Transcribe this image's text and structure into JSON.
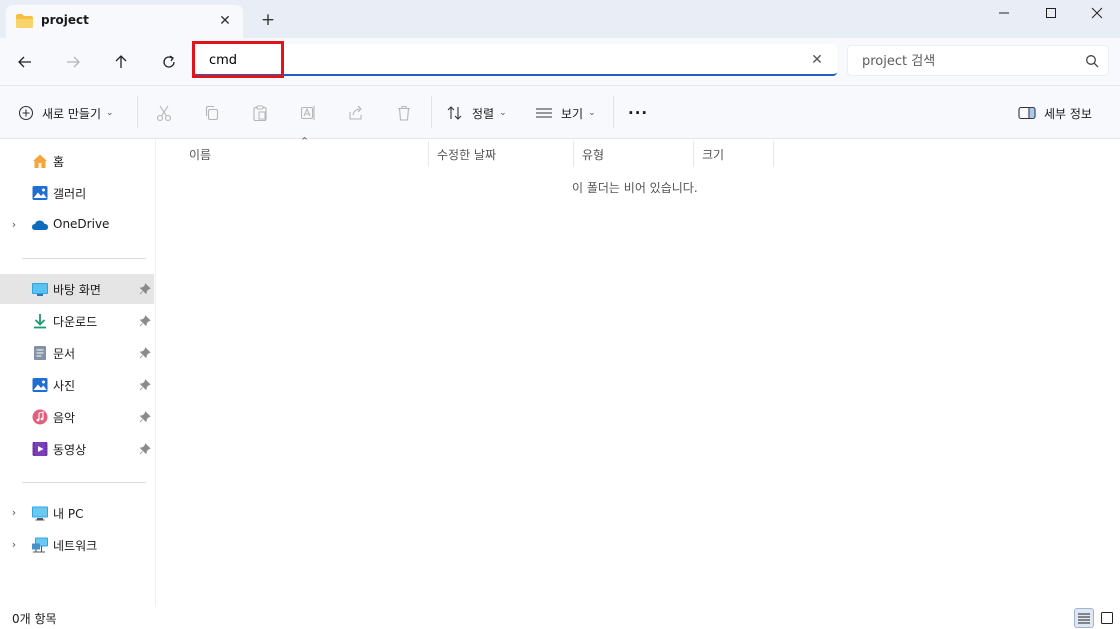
{
  "tab": {
    "title": "project",
    "close": "✕",
    "new_tab": "+"
  },
  "address": {
    "value": "cmd",
    "clear": "✕"
  },
  "search": {
    "placeholder": "project 검색"
  },
  "commands": {
    "new": "새로 만들기",
    "sort": "정렬",
    "view": "보기",
    "more": "···",
    "details": "세부 정보",
    "chevron": "⌄"
  },
  "sidebar": {
    "quick": [
      {
        "label": "홈",
        "icon": "home-icon"
      },
      {
        "label": "갤러리",
        "icon": "gallery-icon"
      },
      {
        "label": "OneDrive",
        "icon": "cloud-icon"
      }
    ],
    "pinned": [
      {
        "label": "바탕 화면",
        "icon": "desktop-icon"
      },
      {
        "label": "다운로드",
        "icon": "download-icon"
      },
      {
        "label": "문서",
        "icon": "document-icon"
      },
      {
        "label": "사진",
        "icon": "pictures-icon"
      },
      {
        "label": "음악",
        "icon": "music-icon"
      },
      {
        "label": "동영상",
        "icon": "video-icon"
      }
    ],
    "devices": [
      {
        "label": "내 PC",
        "icon": "pc-icon"
      },
      {
        "label": "네트워크",
        "icon": "network-icon"
      }
    ]
  },
  "columns": [
    "이름",
    "수정한 날짜",
    "유형",
    "크기"
  ],
  "empty_message": "이 폴더는 비어 있습니다.",
  "status": {
    "item_count": "0개 항목"
  },
  "colors": {
    "accent": "#1f5fbf",
    "highlight": "#e0151b",
    "folder": "#f5c042"
  }
}
